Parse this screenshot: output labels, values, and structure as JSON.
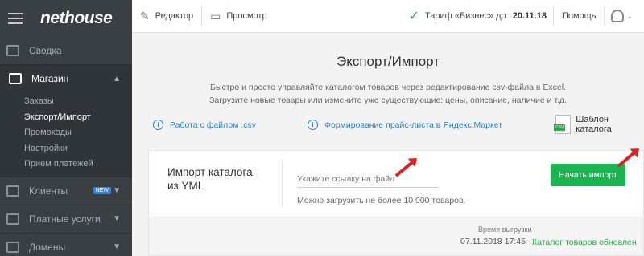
{
  "app": {
    "logo": "nethouse"
  },
  "sidebar": {
    "items": [
      {
        "label": "Сводка"
      },
      {
        "label": "Магазин"
      },
      {
        "label": "Клиенты",
        "badge": "NEW"
      },
      {
        "label": "Платные услуги"
      },
      {
        "label": "Домены"
      }
    ],
    "submenu": [
      "Заказы",
      "Экспорт/Импорт",
      "Промокоды",
      "Настройки",
      "Прием платежей"
    ]
  },
  "topbar": {
    "editor": "Редактор",
    "preview": "Просмотр",
    "tariff": "Тариф «Бизнес» до:",
    "tariff_date": "20.11.18",
    "help": "Помощь"
  },
  "main": {
    "title": "Экспорт/Импорт",
    "desc_line1": "Быстро и просто управляйте каталогом товаров через редактирование csv-файла в Excel.",
    "desc_line2": "Загрузите новые товары или измените уже существующие: цены, описание, наличие и т.д.",
    "link_csv": "Работа с файлом .csv",
    "link_yandex": "Формирование прайс-листа в Яндекс.Маркет",
    "link_template": "Шаблон каталога",
    "csv_badge": "CSV"
  },
  "import": {
    "title_line1": "Импорт каталога",
    "title_line2": "из YML",
    "placeholder": "Укажите ссылку на файл",
    "hint": "Можно загрузить не более 10 000 товаров.",
    "button": "Начать импорт",
    "export_label": "Время выгрузки",
    "export_time": "07.11.2018 17:45",
    "status": "Каталог товаров обновлен"
  },
  "colors": {
    "accent_green": "#1ab551",
    "link_blue": "#2f7fd1",
    "sidebar": "#3a3f44",
    "annotation_red": "#e02020"
  }
}
